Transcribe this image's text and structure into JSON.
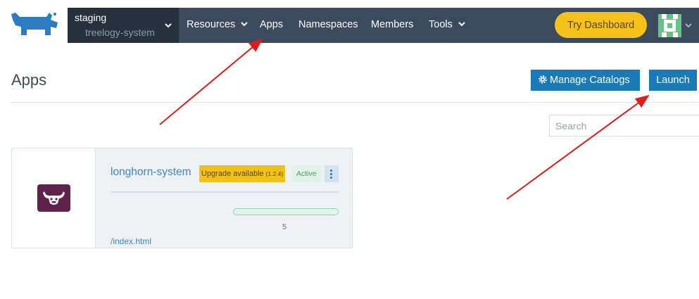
{
  "header": {
    "cluster": {
      "name": "staging",
      "project": "treelogy-system"
    },
    "nav": [
      {
        "label": "Resources",
        "has_menu": true
      },
      {
        "label": "Apps",
        "has_menu": false
      },
      {
        "label": "Namespaces",
        "has_menu": false
      },
      {
        "label": "Members",
        "has_menu": false
      },
      {
        "label": "Tools",
        "has_menu": true
      }
    ],
    "try_dashboard_label": "Try Dashboard",
    "brand_color": "#3b4a5c",
    "accent_color": "#f4c21b"
  },
  "page": {
    "title": "Apps",
    "manage_catalogs_label": "Manage Catalogs",
    "launch_label": "Launch",
    "search_placeholder": "Search",
    "primary_color": "#1a7ab8"
  },
  "apps": [
    {
      "name": "longhorn-system",
      "upgrade_label": "Upgrade available",
      "upgrade_version": "(1.2.4)",
      "status": "Active",
      "workload_count": "5",
      "workload_progress": 1.0,
      "endpoint": "/index.html",
      "icon": "longhorn-bull-icon",
      "icon_color": "#5f224a"
    }
  ],
  "annotations": {
    "arrow_color": "#e01b1b",
    "arrow_count": 2
  }
}
